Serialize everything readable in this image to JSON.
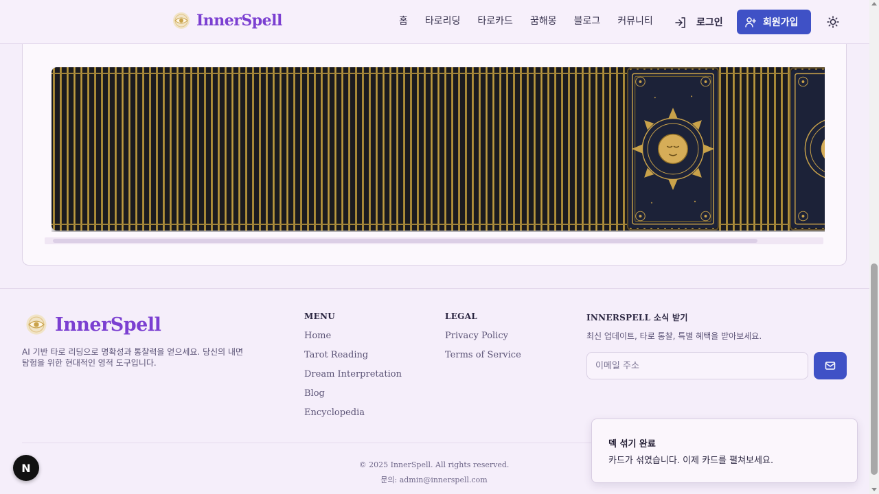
{
  "header": {
    "brand": "InnerSpell",
    "nav": [
      "홈",
      "타로리딩",
      "타로카드",
      "꿈해몽",
      "블로그",
      "커뮤니티"
    ],
    "login_label": "로그인",
    "signup_label": "회원가입"
  },
  "deck": {
    "stripe_colors": [
      "#1b1b1f",
      "#c5a248"
    ],
    "card_back_colors": {
      "background": "#1c2238",
      "gold": "#c9a24a"
    }
  },
  "footer": {
    "brand": "InnerSpell",
    "description": "AI 기반 타로 리딩으로 명확성과 통찰력을 얻으세요. 당신의 내면 탐험을 위한 현대적인 영적 도구입니다.",
    "menu": {
      "title": "MENU",
      "links": [
        "Home",
        "Tarot Reading",
        "Dream Interpretation",
        "Blog",
        "Encyclopedia"
      ]
    },
    "legal": {
      "title": "LEGAL",
      "links": [
        "Privacy Policy",
        "Terms of Service"
      ]
    },
    "newsletter": {
      "title": "INNERSPELL 소식 받기",
      "description": "최신 업데이트, 타로 통찰, 특별 혜택을 받아보세요.",
      "email_placeholder": "이메일 주소"
    },
    "copyright": "© 2025 InnerSpell. All rights reserved.",
    "contact": "문의: admin@innerspell.com"
  },
  "toast": {
    "title": "덱 섞기 완료",
    "message": "카드가 섞였습니다. 이제 카드를 펼쳐보세요."
  },
  "badge": {
    "letter": "N"
  },
  "colors": {
    "brand_purple": "#7b3fd1",
    "primary_blue": "#3f51c6",
    "page_bg": "#f5eefa"
  },
  "icons": {
    "login": "login-icon",
    "signup": "user-plus-icon",
    "theme": "sun-icon",
    "send": "mail-icon",
    "logo": "eye-sun-logo-icon"
  }
}
